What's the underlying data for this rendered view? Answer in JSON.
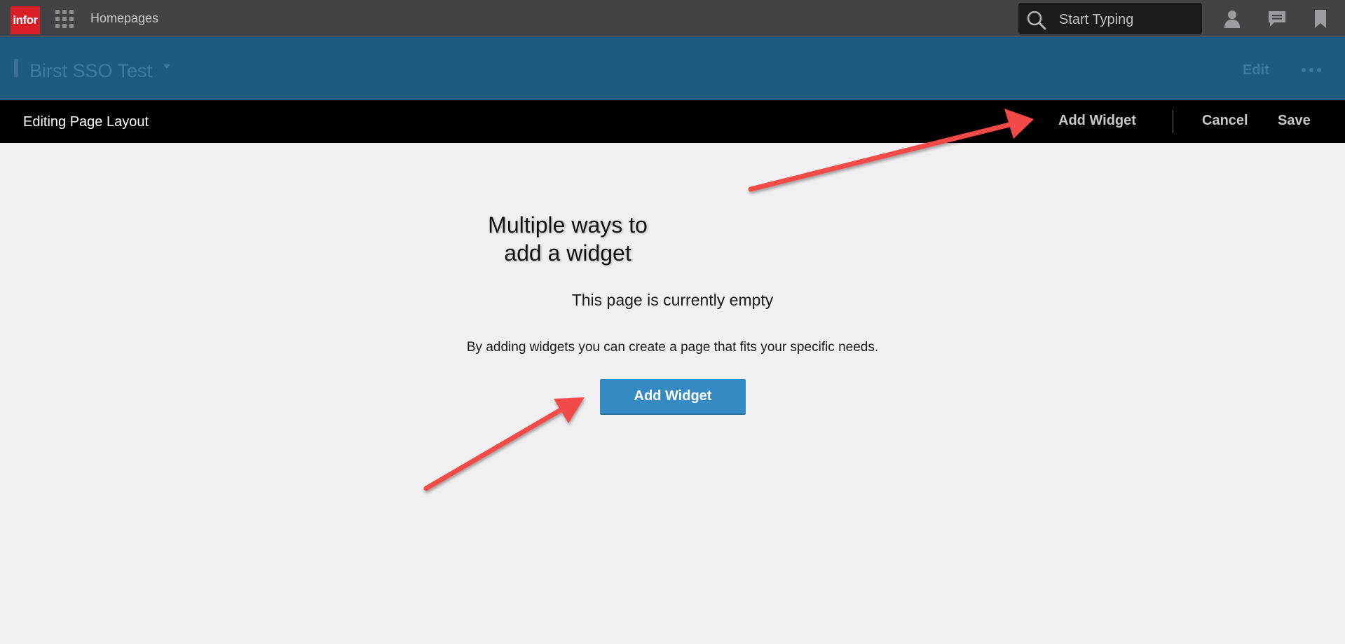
{
  "topbar": {
    "logo_text": "infor",
    "nav_link": "Homepages",
    "search_placeholder": "Start Typing",
    "icons": [
      "app-grid-icon",
      "search-icon",
      "user-icon",
      "chat-icon",
      "bookmark-icon"
    ]
  },
  "pagebar": {
    "title": "Birst SSO Test",
    "edit_label": "Edit",
    "more_icon": "ellipsis-icon"
  },
  "editbar": {
    "label": "Editing Page Layout",
    "add_widget_label": "Add Widget",
    "cancel_label": "Cancel",
    "save_label": "Save"
  },
  "content": {
    "annotation_line1": "Multiple ways to",
    "annotation_line2": "add a widget",
    "empty_title": "This page is currently empty",
    "empty_description": "By adding widgets you can create a page that fits your specific needs.",
    "add_widget_button": "Add Widget"
  },
  "colors": {
    "topbar_bg": "#424347",
    "pagebar_bg": "#1f5b80",
    "editbar_bg": "#000000",
    "logo_bg": "#da1e28",
    "primary_button": "#368ac3",
    "annotation_arrow": "#f24a4a",
    "content_bg": "#f0f0f0"
  }
}
